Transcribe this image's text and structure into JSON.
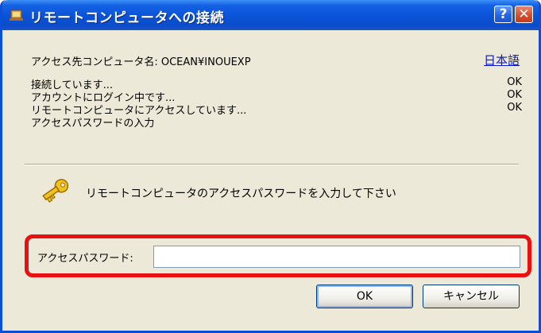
{
  "window": {
    "title": "リモートコンピュータへの接続"
  },
  "info": {
    "target_label": "アクセス先コンピュータ名: OCEAN¥INOUEXP",
    "language_link": "日本語"
  },
  "progress": [
    {
      "text": "接続しています...",
      "status": "OK"
    },
    {
      "text": "アカウントにログイン中です...",
      "status": "OK"
    },
    {
      "text": "リモートコンピュータにアクセスしています...",
      "status": "OK"
    },
    {
      "text": "アクセスパスワードの入力",
      "status": ""
    }
  ],
  "prompt": {
    "instruction": "リモートコンピュータのアクセスパスワードを入力して下さい"
  },
  "password": {
    "label": "アクセスパスワード:",
    "value": "",
    "placeholder": ""
  },
  "buttons": {
    "ok": "OK",
    "cancel": "キャンセル"
  },
  "colors": {
    "titlebar": "#0a52d8",
    "highlight": "#e81010",
    "link": "#0b19c6",
    "dialog_bg": "#ece9d8"
  },
  "icons": {
    "title": "remote-connection-icon",
    "key": "key-icon",
    "help": "help-icon",
    "close": "close-icon"
  }
}
